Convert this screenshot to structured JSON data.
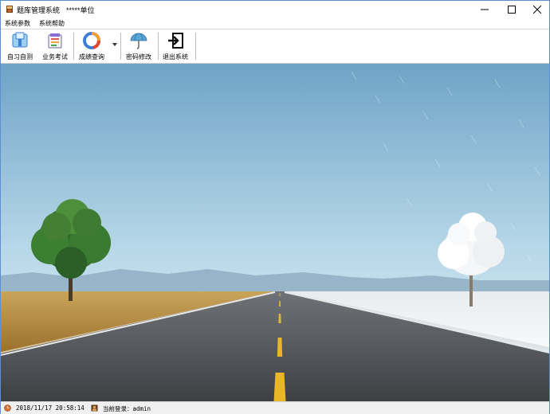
{
  "window": {
    "title": "题库管理系统",
    "unit": "*****单位"
  },
  "menu": [
    {
      "label": "系统参数"
    },
    {
      "label": "系统帮助"
    }
  ],
  "toolbar": {
    "items": [
      {
        "label": "自习自测",
        "icon": "study-icon"
      },
      {
        "label": "业务考试",
        "icon": "exam-icon"
      },
      {
        "label": "成绩查询",
        "icon": "chart-pie-icon"
      },
      {
        "label": "密码修改",
        "icon": "umbrella-icon"
      },
      {
        "label": "退出系统",
        "icon": "exit-icon"
      }
    ]
  },
  "status": {
    "datetime": "2018/11/17 20:58:14",
    "login": "当前登录：admin"
  },
  "colors": {
    "accent": "#3c7fd4",
    "sky_top": "#6fa3c7",
    "sky_bottom": "#d9ecf2",
    "field": "#b88a3c",
    "snow": "#f2f4f6",
    "road": "#4a4c50",
    "center_line": "#e9b62a"
  }
}
